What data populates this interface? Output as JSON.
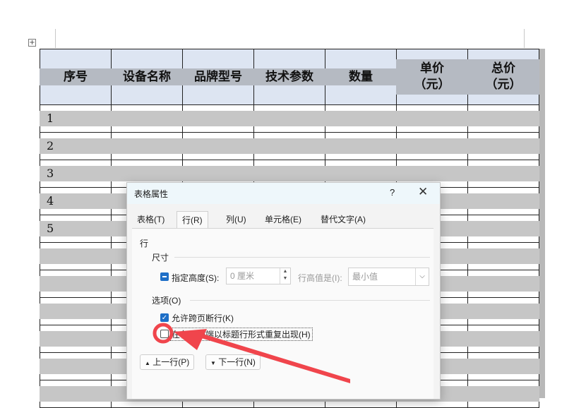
{
  "table": {
    "headers": [
      "序号",
      "设备名称",
      "品牌型号",
      "技术参数",
      "数量"
    ],
    "price_header": {
      "line1": "单价",
      "line2": "（元）"
    },
    "total_header": {
      "line1": "总价",
      "line2": "（元）"
    },
    "row_numbers": [
      "1",
      "2",
      "3",
      "4",
      "5",
      "",
      "",
      "",
      "",
      "",
      ""
    ]
  },
  "dialog": {
    "title": "表格属性",
    "help": "?",
    "close": "✕",
    "tabs": [
      "表格(T)",
      "行(R)",
      "列(U)",
      "单元格(E)",
      "替代文字(A)"
    ],
    "active_tab": "行(R)",
    "section_row": "行",
    "size_label": "尺寸",
    "specify_height_label": "指定高度(S):",
    "height_value": "0 厘米",
    "row_height_label": "行高值是(I):",
    "row_height_value": "最小值",
    "options_label": "选项(O)",
    "allow_break_label": "允许跨页断行(K)",
    "repeat_header_label": "在各页顶端以标题行形式重复出现(H)",
    "prev_row_label": "上一行(P)",
    "next_row_label": "下一行(N)"
  },
  "colors": {
    "header_fill": "#dde5f2",
    "cell_highlight": "#c6c6c6",
    "checkbox_blue": "#1e6fc7",
    "annotation_red": "#f0454c"
  },
  "icons": {
    "move_handle": "table-move-handle-icon",
    "up_arrow": "▲",
    "down_arrow": "▼"
  }
}
